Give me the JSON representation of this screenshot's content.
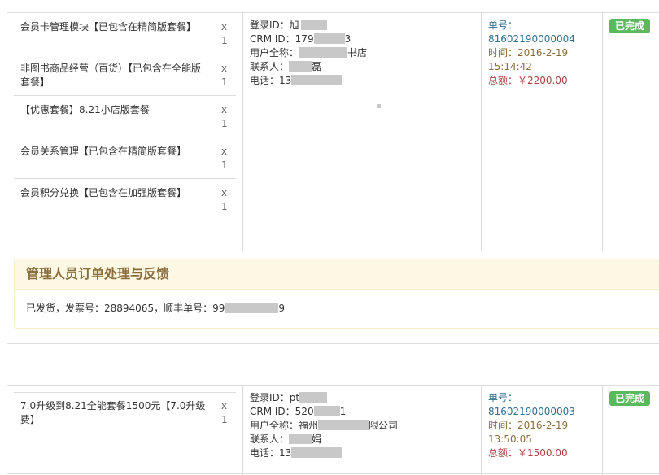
{
  "orders": [
    {
      "items": [
        {
          "name": "会员卡管理模块【已包含在精简版套餐】",
          "qty": "x\n1"
        },
        {
          "name": "非图书商品经营（百货）【已包含在全能版套餐】",
          "qty": "x\n1"
        },
        {
          "name": "【优惠套餐】8.21小店版套餐",
          "qty": "x\n1"
        },
        {
          "name": "会员关系管理【已包含在精简版套餐】",
          "qty": "x\n1"
        },
        {
          "name": "会员积分兑换【已包含在加强版套餐】",
          "qty": "x\n1"
        }
      ],
      "user": {
        "login_label": "登录ID：",
        "login_value": "旭",
        "crm_label": "CRM ID：",
        "crm_prefix": "179",
        "crm_suffix": "3",
        "fullname_label": "用户全称：",
        "fullname_suffix": "书店",
        "contact_label": "联系人：",
        "contact_suffix": "磊",
        "phone_label": "电话：",
        "phone_prefix": "13"
      },
      "order": {
        "number_label": "单号：",
        "number": "81602190000004",
        "time_label": "时间：",
        "date": "2016-2-19",
        "time": "15:14:42",
        "amount_label": "总额：",
        "amount": "￥2200.00"
      },
      "status": "已完成",
      "feedback": {
        "title": "管理人员订单处理与反馈",
        "text_prefix": "已发货，发票号：28894065，顺丰单号：99",
        "text_suffix": "9"
      }
    },
    {
      "items": [
        {
          "name": "7.0升级到8.21全能套餐1500元【7.0升级费】",
          "qty": "x\n1"
        }
      ],
      "user": {
        "login_label": "登录ID：",
        "login_value": "pt",
        "crm_label": "CRM ID：",
        "crm_prefix": "520",
        "crm_suffix": "1",
        "fullname_label": "用户全称：",
        "fullname_prefix": "福州",
        "fullname_suffix": "限公司",
        "contact_label": "联系人：",
        "contact_suffix": "娟",
        "phone_label": "电话：",
        "phone_prefix": "13"
      },
      "order": {
        "number_label": "单号：",
        "number": "81602190000003",
        "time_label": "时间：",
        "date": "2016-2-19",
        "time": "13:50:05",
        "amount_label": "总额：",
        "amount": "￥1500.00"
      },
      "status": "已完成"
    }
  ]
}
